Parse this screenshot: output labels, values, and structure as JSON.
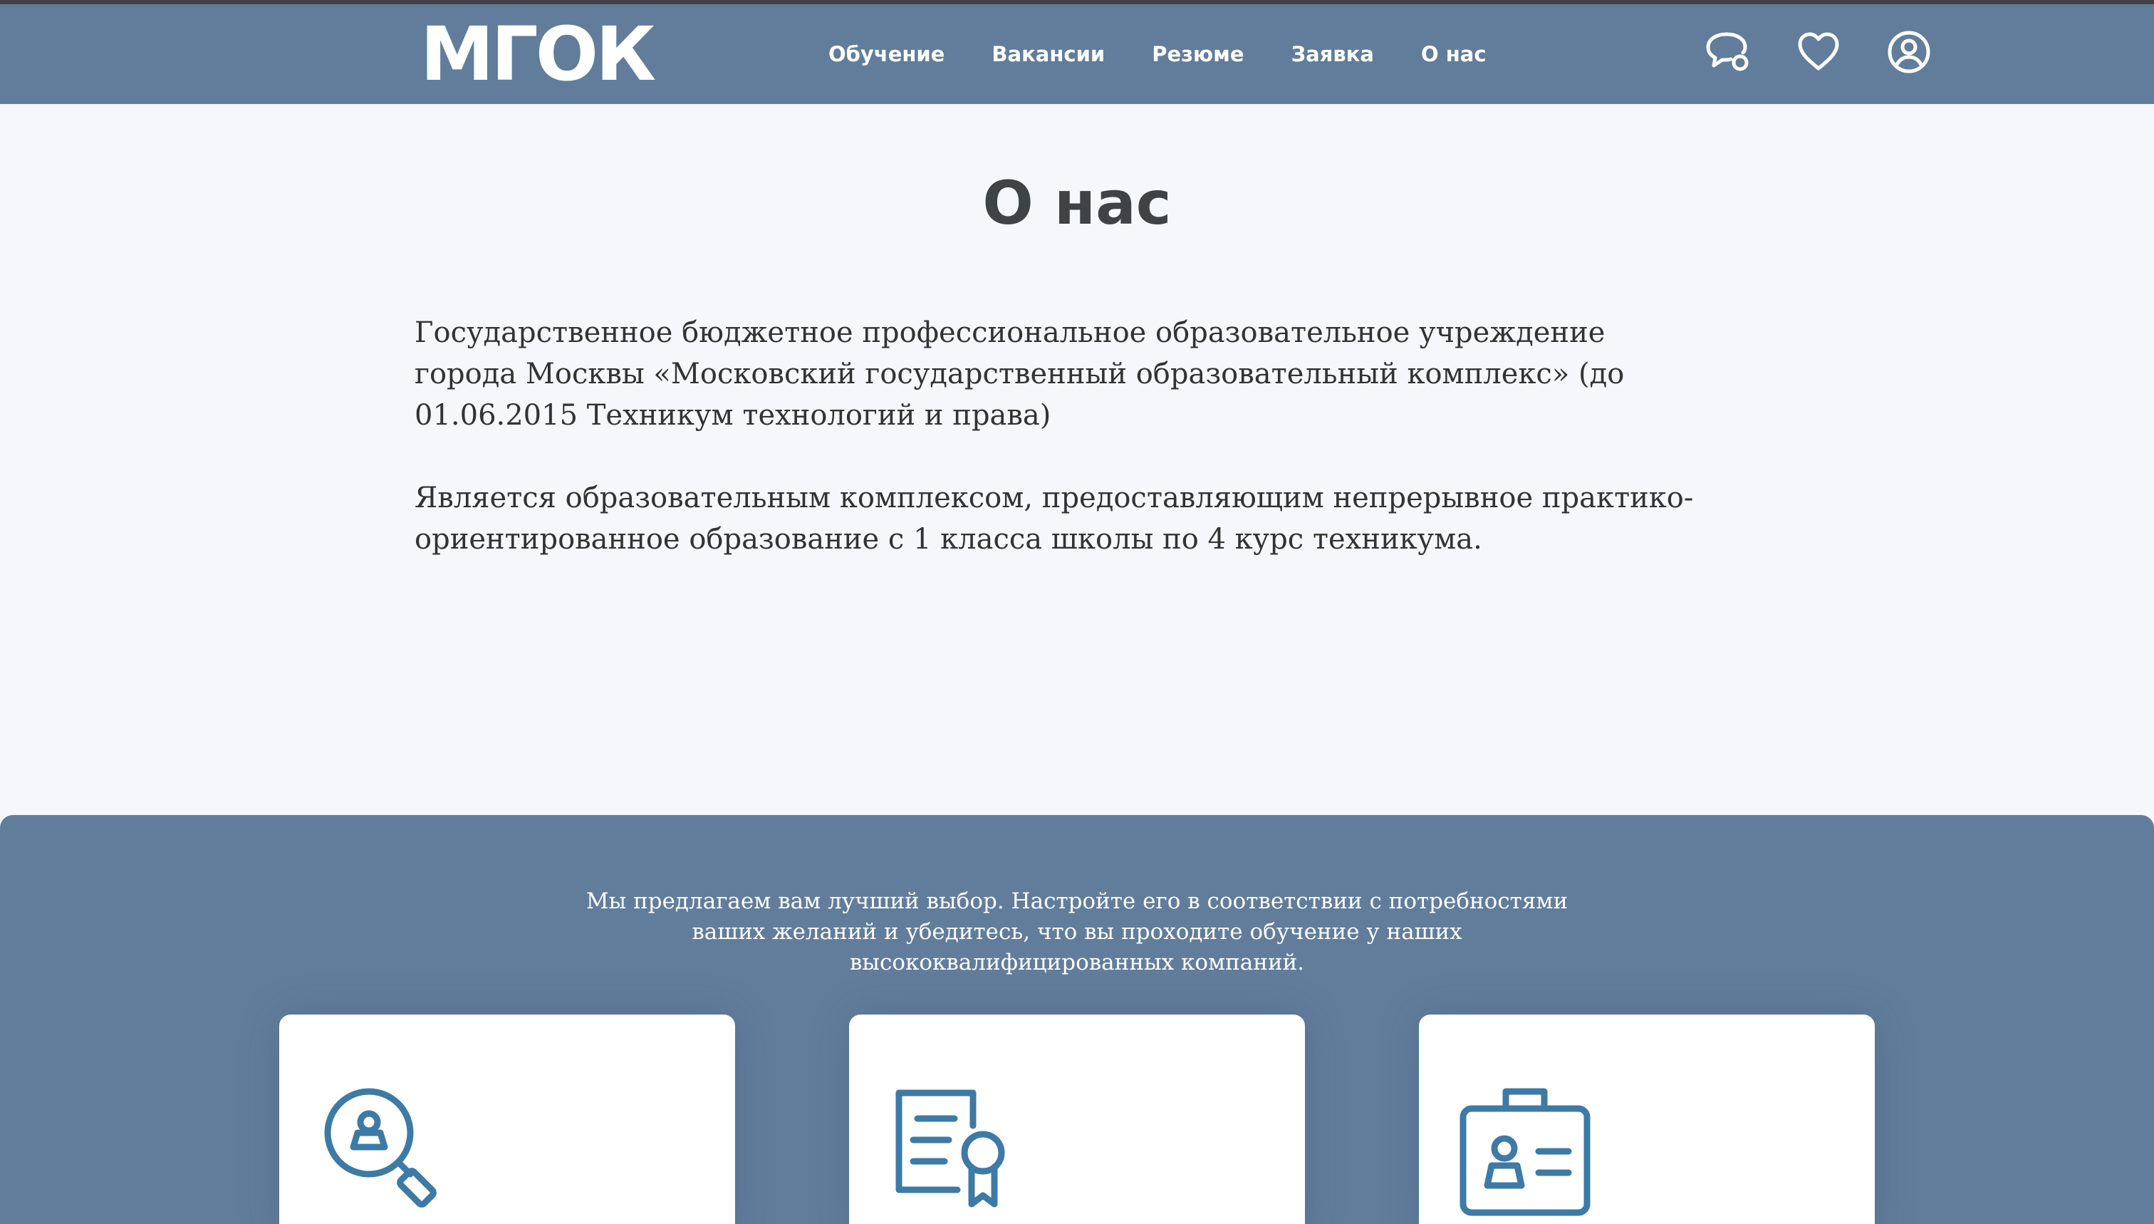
{
  "header": {
    "logo": "МГОК",
    "nav": [
      "Обучение",
      "Вакансии",
      "Резюме",
      "Заявка",
      "О нас"
    ],
    "icons": [
      "chat-icon",
      "heart-icon",
      "user-icon"
    ]
  },
  "page": {
    "title": "О нас",
    "paragraph1": "Государственное бюджетное профессиональное образовательное учреждение города Москвы «Московский государственный образовательный комплекс» (до 01.06.2015 Техникум технологий и права)",
    "paragraph2": "Является образовательным комплексом, предоставляющим непрерывное практико-ориентированное образование с 1 класса школы по 4 курс техникума."
  },
  "features": {
    "text": "Мы предлагаем вам лучший выбор. Настройте его в соответствии с потребностями ваших желаний и убедитесь, что вы проходите обучение у наших высококвалифицированных компаний.",
    "cards": [
      {
        "icon": "person-search-icon"
      },
      {
        "icon": "certificate-icon"
      },
      {
        "icon": "id-badge-icon"
      }
    ]
  },
  "colors": {
    "header_bg": "#617d9b",
    "page_bg": "#f5f7fa",
    "icon_accent": "#3d7aa6",
    "title_text": "#3f4346"
  }
}
